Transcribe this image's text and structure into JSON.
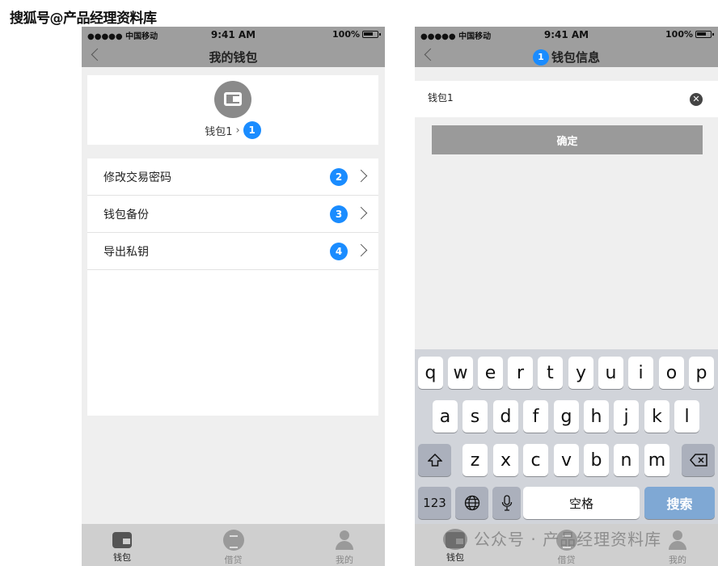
{
  "watermark_top": "搜狐号@产品经理资料库",
  "watermark_bottom": "公众号 · 产品经理资料库",
  "status_bar": {
    "carrier": "●●●●● 中国移动",
    "time": "9:41 AM",
    "battery": "100%"
  },
  "screen1": {
    "title": "我的钱包",
    "wallet_name": "钱包1",
    "wallet_badge": "1",
    "menu": [
      {
        "label": "修改交易密码",
        "badge": "2"
      },
      {
        "label": "钱包备份",
        "badge": "3"
      },
      {
        "label": "导出私钥",
        "badge": "4"
      }
    ]
  },
  "screen2": {
    "title": "钱包信息",
    "title_badge": "1",
    "input_value": "钱包1",
    "confirm_label": "确定",
    "keyboard": {
      "row1": [
        "q",
        "w",
        "e",
        "r",
        "t",
        "y",
        "u",
        "i",
        "o",
        "p"
      ],
      "row2": [
        "a",
        "s",
        "d",
        "f",
        "g",
        "h",
        "j",
        "k",
        "l"
      ],
      "row3": [
        "z",
        "x",
        "c",
        "v",
        "b",
        "n",
        "m"
      ],
      "numbers_key": "123",
      "space_key": "空格",
      "search_key": "搜索"
    }
  },
  "tabbar": {
    "tabs": [
      "钱包",
      "借贷",
      "我的"
    ],
    "active": "钱包"
  }
}
